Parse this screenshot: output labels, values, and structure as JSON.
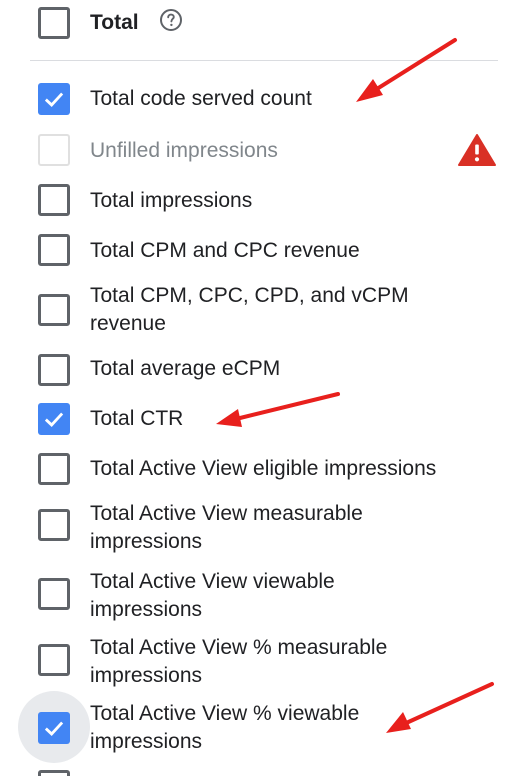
{
  "header": {
    "label": "Total"
  },
  "items": [
    {
      "label": "Total code served count",
      "checked": true
    },
    {
      "label": "Unfilled impressions",
      "checked": false,
      "disabled": true
    },
    {
      "label": "Total impressions",
      "checked": false
    },
    {
      "label": "Total CPM and CPC revenue",
      "checked": false
    },
    {
      "label": "Total CPM, CPC, CPD, and vCPM revenue",
      "checked": false
    },
    {
      "label": "Total average eCPM",
      "checked": false
    },
    {
      "label": "Total CTR",
      "checked": true
    },
    {
      "label": "Total Active View eligible impressions",
      "checked": false
    },
    {
      "label": "Total Active View measurable impressions",
      "checked": false
    },
    {
      "label": "Total Active View viewable impressions",
      "checked": false
    },
    {
      "label": "Total Active View % measurable impressions",
      "checked": false
    },
    {
      "label": "Total Active View % viewable impressions",
      "checked": true,
      "focused": true
    }
  ],
  "icons": {
    "help": "help-circle-icon",
    "warning": "warning-triangle-icon",
    "check": "checkmark-icon"
  },
  "colors": {
    "checkbox_checked": "#4285f4",
    "checkbox_border": "#5f6368",
    "disabled": "#e0e0e0",
    "warning": "#d93025",
    "annotation_arrow": "#e8201d"
  }
}
